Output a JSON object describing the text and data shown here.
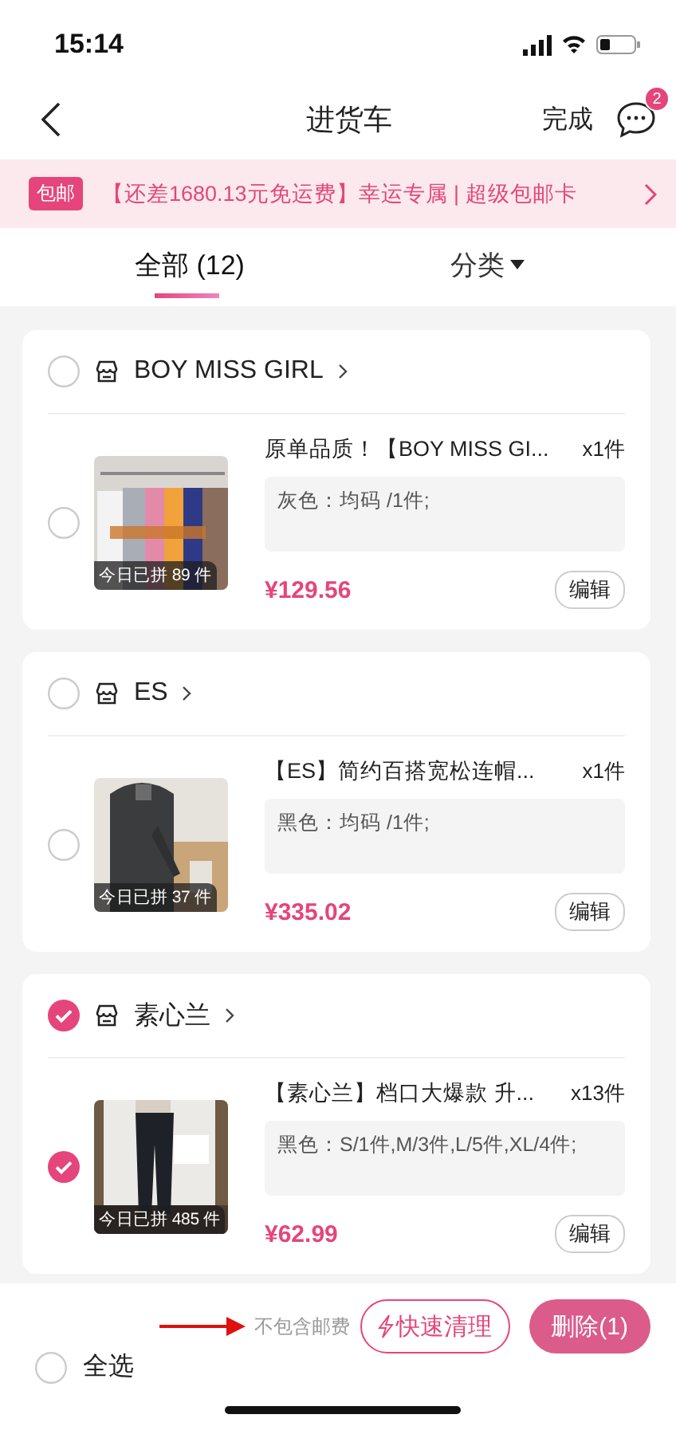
{
  "status_bar": {
    "time": "15:14"
  },
  "nav": {
    "title": "进货车",
    "action": "完成",
    "message_badge": "2"
  },
  "banner": {
    "tag": "包邮",
    "text": "【还差1680.13元免运费】幸运专属 | 超级包邮卡"
  },
  "tabs": [
    {
      "label": "全部 (12)",
      "selected": true,
      "kind": "tab"
    },
    {
      "label": "分类",
      "selected": false,
      "kind": "dropdown"
    }
  ],
  "shops": [
    {
      "name": "BOY MISS GIRL",
      "checked": false,
      "items": [
        {
          "title": "原单品质！【BOY MISS GI...",
          "quantity": "x1件",
          "spec": "灰色：均码 /1件;",
          "sold_today": "今日已拼 89 件",
          "price": "¥129.56",
          "edit": "编辑",
          "checked": false
        }
      ]
    },
    {
      "name": "ES",
      "checked": false,
      "items": [
        {
          "title": "【ES】简约百搭宽松连帽...",
          "quantity": "x1件",
          "spec": "黑色：均码 /1件;",
          "sold_today": "今日已拼 37 件",
          "price": "¥335.02",
          "edit": "编辑",
          "checked": false
        }
      ]
    },
    {
      "name": "素心兰",
      "checked": true,
      "items": [
        {
          "title": "【素心兰】档口大爆款 升...",
          "quantity": "x13件",
          "spec": "黑色：S/1件,M/3件,L/5件,XL/4件;",
          "sold_today": "今日已拼 485 件",
          "price": "¥62.99",
          "edit": "编辑",
          "checked": true
        }
      ]
    }
  ],
  "footer": {
    "select_all": "全选",
    "select_all_checked": false,
    "note": "不包含邮费",
    "quick_clean": "快速清理",
    "delete": "删除(1)"
  }
}
